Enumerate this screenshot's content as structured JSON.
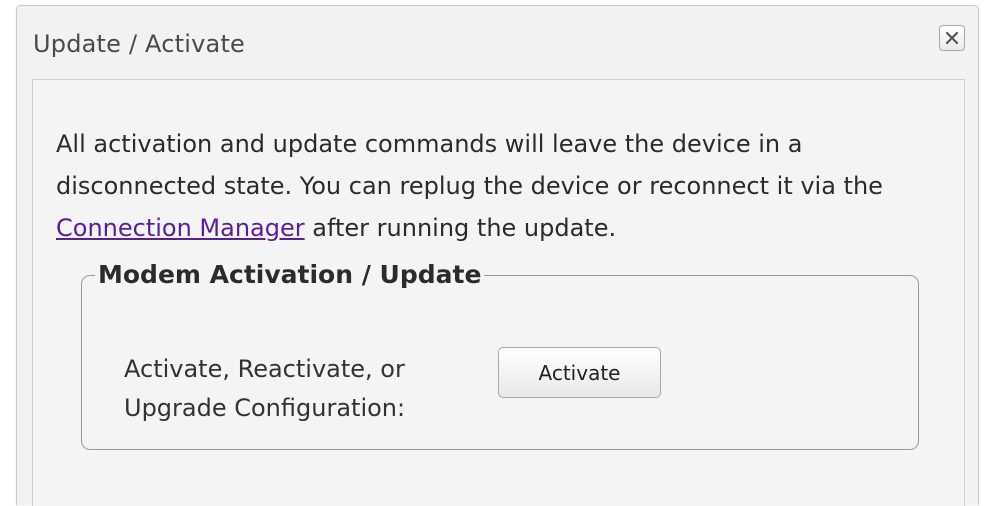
{
  "dialog": {
    "title": "Update / Activate",
    "close_icon": "close-icon"
  },
  "content": {
    "description_before_link": "All activation and update commands will leave the device in a disconnected state. You can replug the device or reconnect it via the ",
    "link_text": "Connection Manager",
    "description_after_link": " after running the update."
  },
  "modem_group": {
    "legend": "Modem Activation / Update",
    "field_label_line1": "Activate, Reactivate, or",
    "field_label_line2": "Upgrade Configuration:",
    "activate_button": "Activate"
  },
  "colors": {
    "link": "#5a1e9b",
    "dialog_background": "#f2f2f2",
    "text": "#2b2b2b"
  }
}
